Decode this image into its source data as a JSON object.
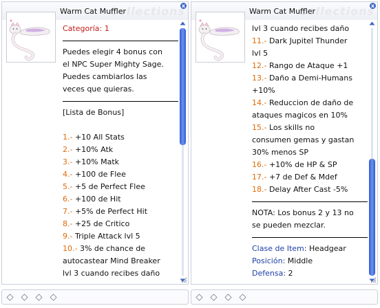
{
  "windows": [
    {
      "title": "Warm Cat Muffler",
      "watermark": "Collections",
      "close_label": "x",
      "lines": [
        {
          "t": "Categoría: 1",
          "c": "red"
        },
        {
          "sep": true
        },
        {
          "t": "Puedes elegir 4 bonus con"
        },
        {
          "t": "el NPC Super Mighty Sage."
        },
        {
          "t": "Puedes cambiarlos las"
        },
        {
          "t": "veces que quieras."
        },
        {
          "sep": true
        },
        {
          "t": "[Lista de Bonus]"
        },
        {
          "blank": true
        },
        {
          "n": "1.-",
          "t": " +10 All Stats"
        },
        {
          "n": "2.-",
          "t": " +10% Atk"
        },
        {
          "n": "3.-",
          "t": " +10% Matk"
        },
        {
          "n": "4.-",
          "t": " +100 de Flee"
        },
        {
          "n": "5.-",
          "t": " +5 de Perfect Flee"
        },
        {
          "n": "6.-",
          "t": " +100 de Hit"
        },
        {
          "n": "7.-",
          "t": " +5% de Perfect Hit"
        },
        {
          "n": "8.-",
          "t": " +25 de Critico"
        },
        {
          "n": "9.-",
          "t": " Triple Attack lvl 5"
        },
        {
          "n": "10.-",
          "t": " 3% de chance de"
        },
        {
          "t": "autocastear Mind Breaker"
        },
        {
          "t": "lvl 3 cuando recibes daño"
        }
      ],
      "scroll_position": 0.0
    },
    {
      "title": "Warm Cat Muffler",
      "watermark": "Collections",
      "close_label": "x",
      "lines": [
        {
          "t": "lvl 3 cuando recibes daño"
        },
        {
          "n": "11.-",
          "t": " Dark Jupitel Thunder"
        },
        {
          "t": "lvl 5"
        },
        {
          "n": "12.-",
          "t": " Rango de Ataque +1"
        },
        {
          "n": "13.-",
          "t": " Daño a Demi-Humans"
        },
        {
          "t": "+10%"
        },
        {
          "n": "14.-",
          "t": " Reduccion de daño de"
        },
        {
          "t": "ataques magicos en 10%"
        },
        {
          "n": "15.-",
          "t": " Los skills no"
        },
        {
          "t": "consumen gemas y gastan"
        },
        {
          "t": "30% menos SP"
        },
        {
          "n": "16.-",
          "t": " +10% de HP & SP"
        },
        {
          "n": "17.-",
          "t": " +7 de Def & Mdef"
        },
        {
          "n": "18.-",
          "t": " Delay After Cast -5%"
        },
        {
          "sep": true
        },
        {
          "t": "NOTA: Los bonus 2 y 13 no"
        },
        {
          "t": "se pueden mezclar."
        },
        {
          "sep": true
        },
        {
          "k": "Clase de Item:",
          "v": " Headgear"
        },
        {
          "k": "Posición:",
          "v": " Middle"
        },
        {
          "k": "Defensa:",
          "v": " 2"
        }
      ],
      "scroll_position": 1.0
    }
  ],
  "colors": {
    "category": "#c31b17",
    "number": "#e06a08",
    "key": "#1b3fa6",
    "scroll_thumb": "#3c66c8"
  },
  "icons": {
    "item": "cat-muffler-icon",
    "close": "close-icon",
    "scroll_up": "chevron-up-icon",
    "scroll_down": "chevron-down-icon",
    "resize": "resize-grip-icon",
    "slot": "diamond-slot-icon"
  }
}
